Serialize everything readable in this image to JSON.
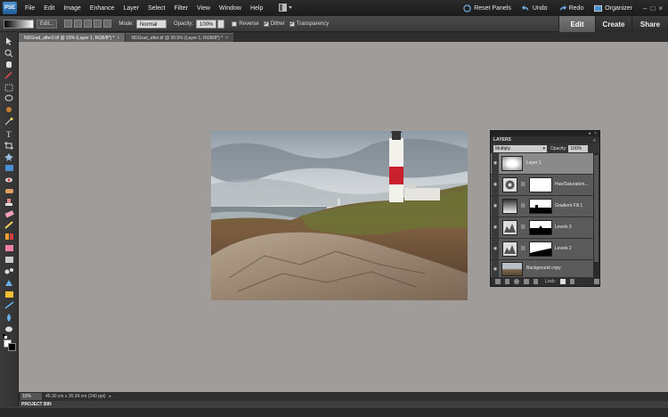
{
  "app": {
    "logo_text": "PSE",
    "menu": [
      "File",
      "Edit",
      "Image",
      "Enhance",
      "Layer",
      "Select",
      "Filter",
      "View",
      "Window",
      "Help"
    ],
    "reset_panels": "Reset Panels",
    "undo": "Undo",
    "redo": "Redo",
    "organizer": "Organizer",
    "window_controls": [
      "–",
      "□",
      "×"
    ]
  },
  "options_bar": {
    "edit_button": "Edit...",
    "mode_label": "Mode:",
    "mode_value": "Normal",
    "opacity_label": "Opacity:",
    "opacity_value": "100%",
    "reverse": "Reverse",
    "dither": "Dither",
    "transparency": "Transparency"
  },
  "mode_tabs": [
    "Edit",
    "Create",
    "Share"
  ],
  "doc_tabs": [
    {
      "label": "NDGrad_after2.tif @ 15% (Layer 1, RGB/8*) *",
      "active": true
    },
    {
      "label": "NDGrad_after.tif @ 30.5% (Layer 1, RGB/8*) *",
      "active": false
    }
  ],
  "layers_panel": {
    "title": "LAYERS",
    "blend_mode": "Multiply",
    "opacity_label": "Opacity:",
    "opacity_value": "100%",
    "lock_label": "Lock:",
    "layers": [
      {
        "name": "Layer 1",
        "selected": true
      },
      {
        "name": "Hue/Saturation...",
        "selected": false
      },
      {
        "name": "Gradient Fill 1",
        "selected": false
      },
      {
        "name": "Levels 3",
        "selected": false
      },
      {
        "name": "Levels 2",
        "selected": false
      },
      {
        "name": "Background copy",
        "selected": false
      }
    ]
  },
  "status_bar": {
    "zoom": "15%",
    "doc_info": "45.30 cm x 30.34 cm (240 ppi)",
    "project_bin": "PROJECT BIN"
  },
  "colors": {
    "workspace": "#a09c99",
    "accent_blue": "#4a8fd1"
  }
}
